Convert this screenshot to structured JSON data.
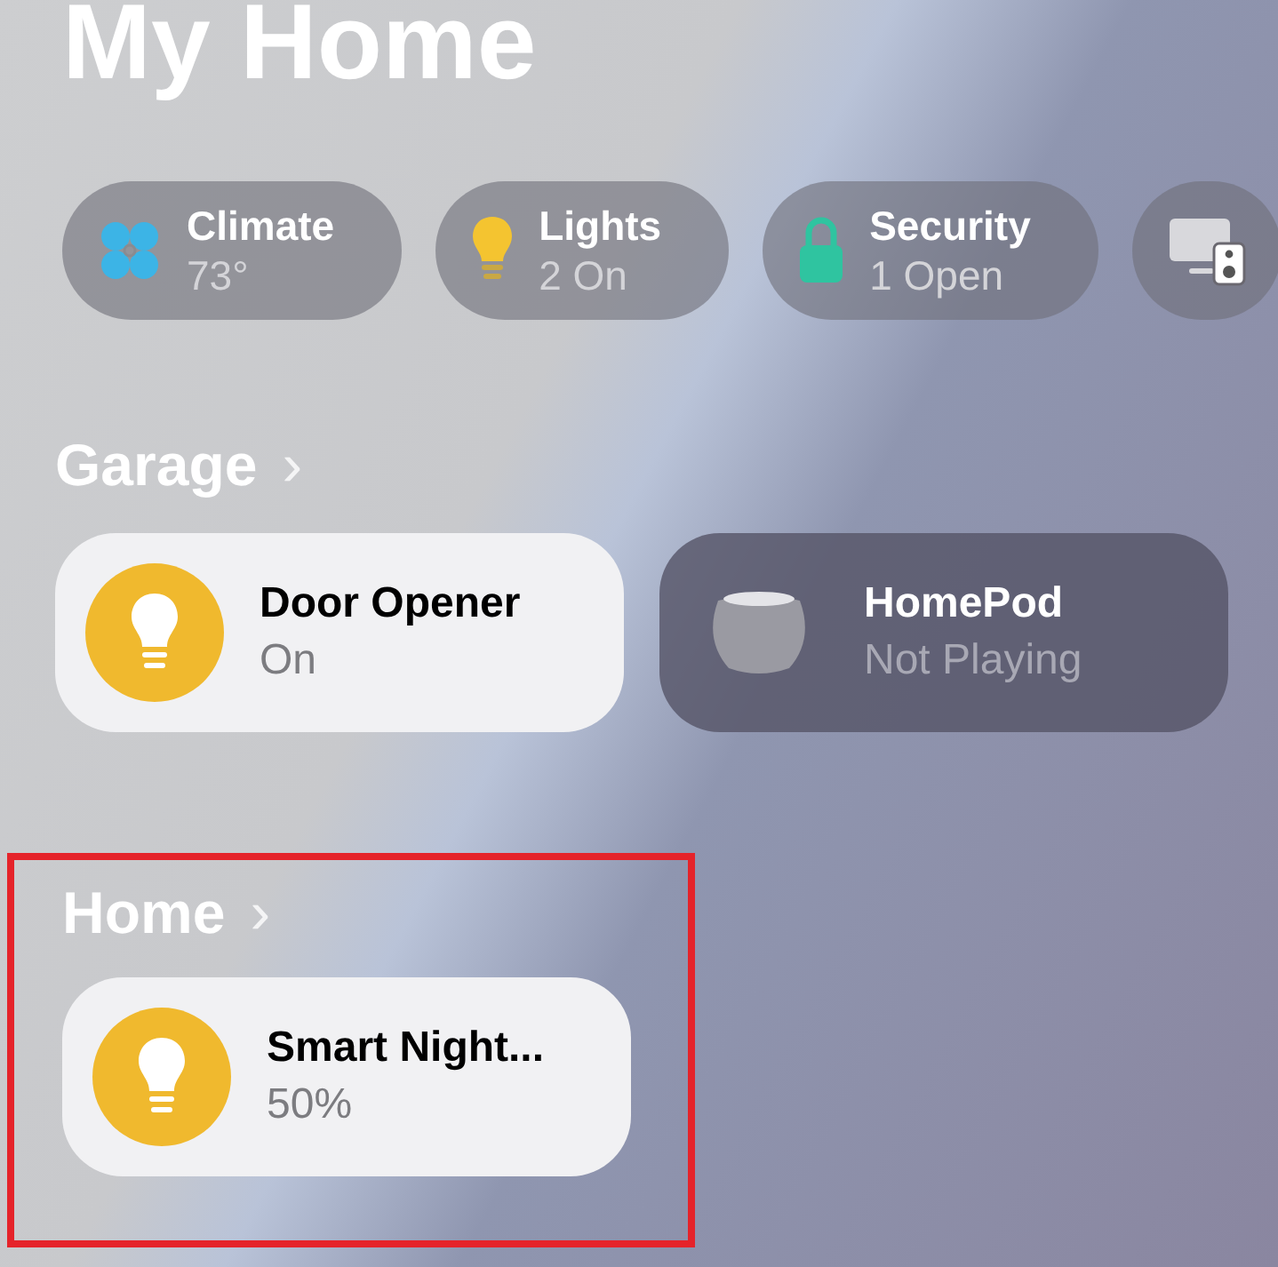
{
  "title": "My Home",
  "categories": [
    {
      "kind": "climate",
      "label": "Climate",
      "status": "73°"
    },
    {
      "kind": "lights",
      "label": "Lights",
      "status": "2 On"
    },
    {
      "kind": "security",
      "label": "Security",
      "status": "1 Open"
    },
    {
      "kind": "media"
    }
  ],
  "rooms": [
    {
      "name": "Garage",
      "chevron": "›",
      "highlighted": false,
      "accessories": [
        {
          "kind": "bulb",
          "name": "Door Opener",
          "status": "On",
          "on": true
        },
        {
          "kind": "homepod",
          "name": "HomePod",
          "status": "Not Playing",
          "on": false
        }
      ]
    },
    {
      "name": "Home",
      "chevron": "›",
      "highlighted": true,
      "accessories": [
        {
          "kind": "bulb",
          "name": "Smart Night...",
          "status": "50%",
          "on": true
        }
      ]
    }
  ]
}
